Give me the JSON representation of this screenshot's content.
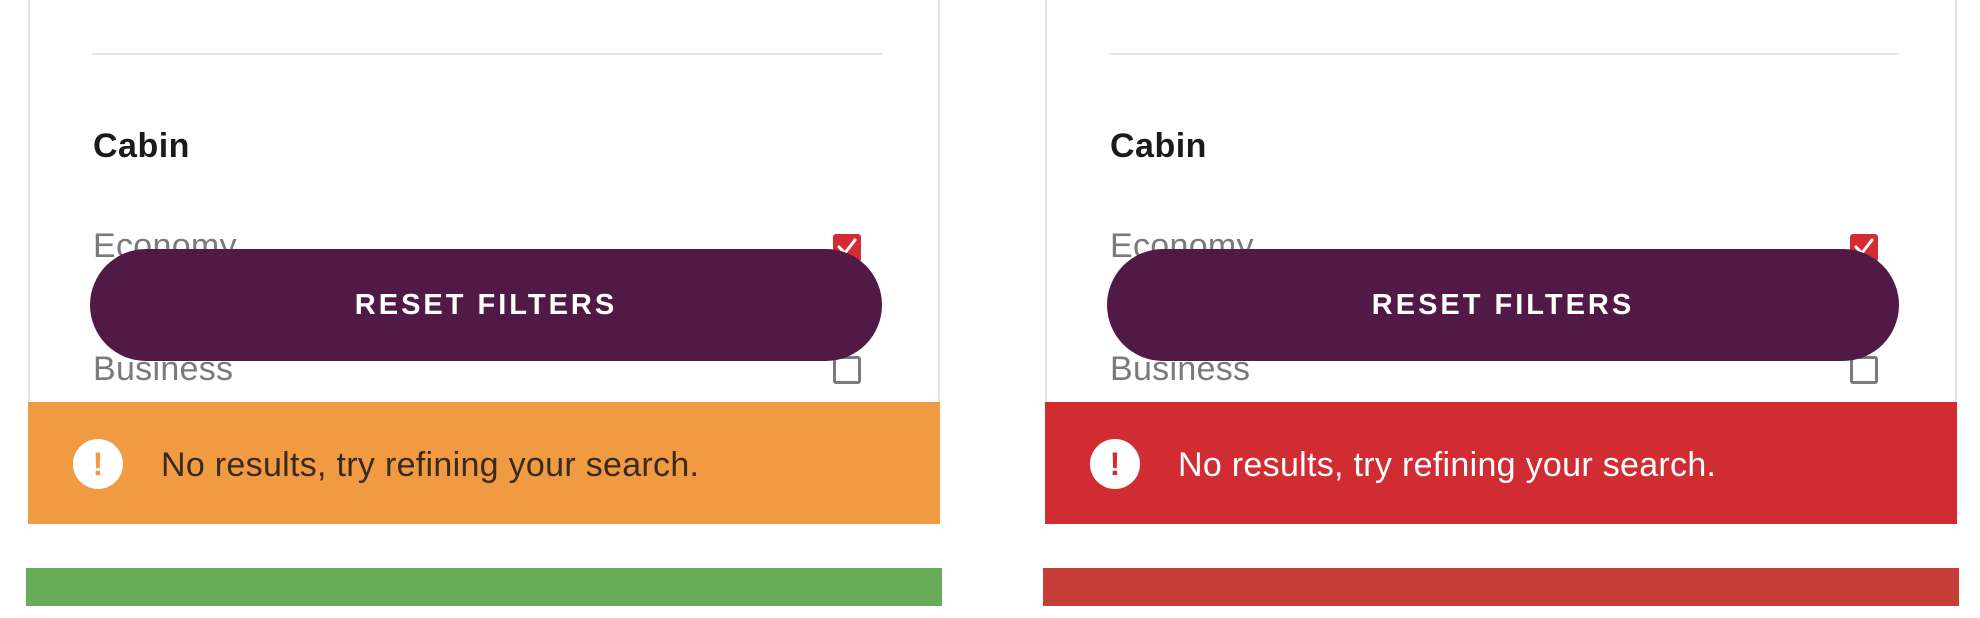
{
  "panels": [
    {
      "variant": "warning",
      "section_title": "Cabin",
      "options": [
        {
          "label": "Economy",
          "checked": true
        },
        {
          "label": "Business",
          "checked": false
        }
      ],
      "reset_label": "RESET FILTERS",
      "toast": {
        "icon": "exclamation-icon",
        "message": "No results, try refining your search.",
        "color": "#f09a42"
      },
      "bottom_bar_color": "#66ab58"
    },
    {
      "variant": "error",
      "section_title": "Cabin",
      "options": [
        {
          "label": "Economy",
          "checked": true
        },
        {
          "label": "Business",
          "checked": false
        }
      ],
      "reset_label": "RESET FILTERS",
      "toast": {
        "icon": "exclamation-icon",
        "message": "No results, try refining your search.",
        "color": "#d22c33"
      },
      "bottom_bar_color": "#c63c36"
    }
  ],
  "colors": {
    "primary": "#511945",
    "checkbox_checked": "#d42b35"
  },
  "icons": {
    "toast_glyph": "!"
  }
}
